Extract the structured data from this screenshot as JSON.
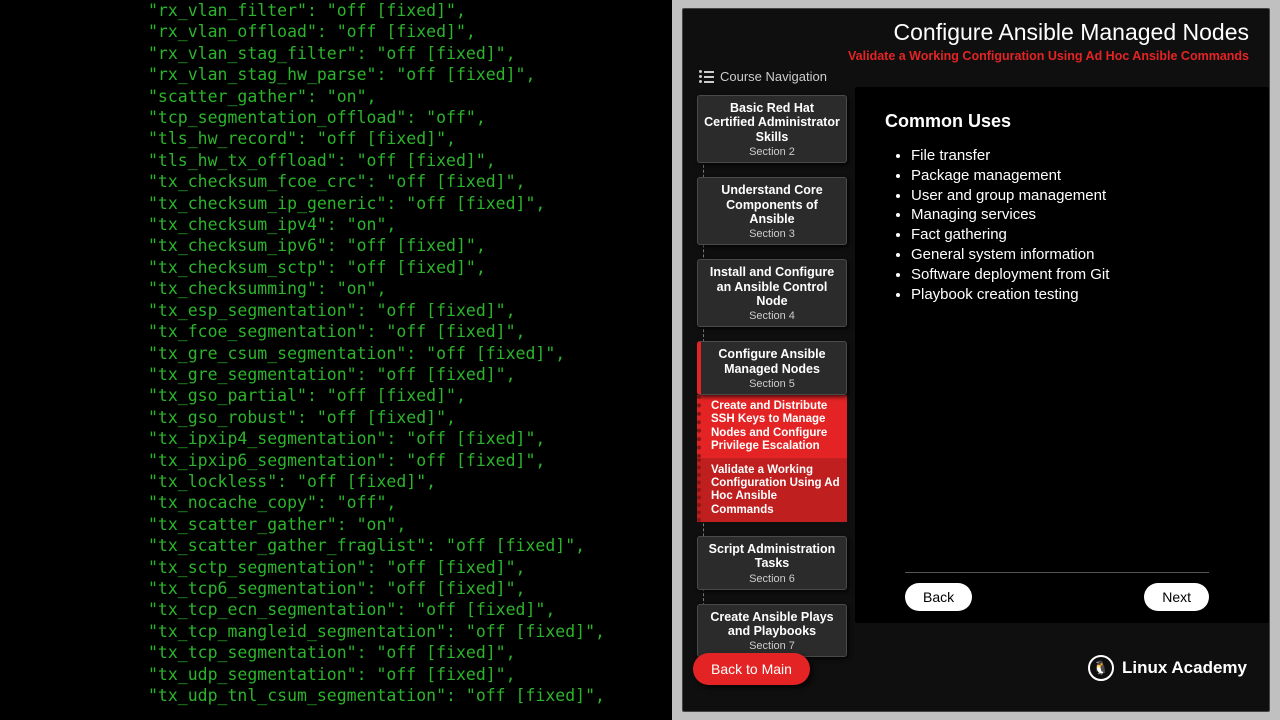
{
  "terminal": {
    "lines": [
      "\"rx_vlan_filter\": \"off [fixed]\",",
      "\"rx_vlan_offload\": \"off [fixed]\",",
      "\"rx_vlan_stag_filter\": \"off [fixed]\",",
      "\"rx_vlan_stag_hw_parse\": \"off [fixed]\",",
      "\"scatter_gather\": \"on\",",
      "\"tcp_segmentation_offload\": \"off\",",
      "\"tls_hw_record\": \"off [fixed]\",",
      "\"tls_hw_tx_offload\": \"off [fixed]\",",
      "\"tx_checksum_fcoe_crc\": \"off [fixed]\",",
      "\"tx_checksum_ip_generic\": \"off [fixed]\",",
      "\"tx_checksum_ipv4\": \"on\",",
      "\"tx_checksum_ipv6\": \"off [fixed]\",",
      "\"tx_checksum_sctp\": \"off [fixed]\",",
      "\"tx_checksumming\": \"on\",",
      "\"tx_esp_segmentation\": \"off [fixed]\",",
      "\"tx_fcoe_segmentation\": \"off [fixed]\",",
      "\"tx_gre_csum_segmentation\": \"off [fixed]\",",
      "\"tx_gre_segmentation\": \"off [fixed]\",",
      "\"tx_gso_partial\": \"off [fixed]\",",
      "\"tx_gso_robust\": \"off [fixed]\",",
      "\"tx_ipxip4_segmentation\": \"off [fixed]\",",
      "\"tx_ipxip6_segmentation\": \"off [fixed]\",",
      "\"tx_lockless\": \"off [fixed]\",",
      "\"tx_nocache_copy\": \"off\",",
      "\"tx_scatter_gather\": \"on\",",
      "\"tx_scatter_gather_fraglist\": \"off [fixed]\",",
      "\"tx_sctp_segmentation\": \"off [fixed]\",",
      "\"tx_tcp6_segmentation\": \"off [fixed]\",",
      "\"tx_tcp_ecn_segmentation\": \"off [fixed]\",",
      "\"tx_tcp_mangleid_segmentation\": \"off [fixed]\",",
      "\"tx_tcp_segmentation\": \"off [fixed]\",",
      "\"tx_udp_segmentation\": \"off [fixed]\",",
      "\"tx_udp_tnl_csum_segmentation\": \"off [fixed]\","
    ]
  },
  "header": {
    "title": "Configure Ansible Managed Nodes",
    "subtitle": "Validate a Working Configuration Using Ad Hoc Ansible Commands"
  },
  "nav": {
    "label": "Course Navigation",
    "sections": [
      {
        "title": "Basic Red Hat Certified Administrator Skills",
        "sec": "Section 2"
      },
      {
        "title": "Understand Core Components of Ansible",
        "sec": "Section 3"
      },
      {
        "title": "Install and Configure an Ansible Control Node",
        "sec": "Section 4"
      },
      {
        "title": "Configure Ansible Managed Nodes",
        "sec": "Section 5"
      },
      {
        "title": "Script Administration Tasks",
        "sec": "Section 6"
      },
      {
        "title": "Create Ansible Plays and Playbooks",
        "sec": "Section 7"
      }
    ],
    "lessons": [
      "Create and Distribute SSH Keys to Manage Nodes and Configure Privilege Escalation",
      "Validate a Working Configuration Using Ad Hoc Ansible Commands"
    ],
    "back_main": "Back to Main"
  },
  "content": {
    "heading": "Common Uses",
    "items": [
      "File transfer",
      "Package management",
      "User and group management",
      "Managing services",
      "Fact gathering",
      "General system information",
      "Software deployment from Git",
      "Playbook creation testing"
    ],
    "back": "Back",
    "next": "Next"
  },
  "brand": "Linux Academy"
}
